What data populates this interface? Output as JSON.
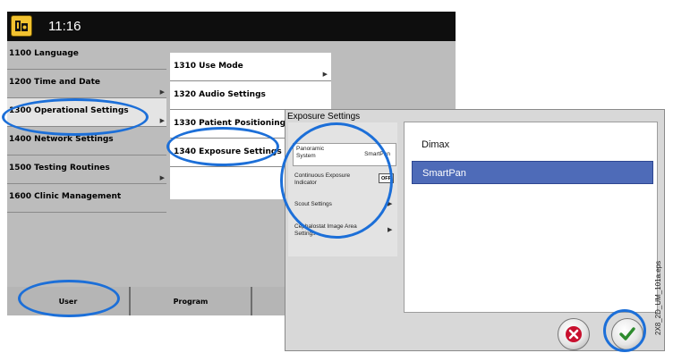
{
  "header": {
    "logo_icon": "panoramic-unit-icon",
    "time": "11:16"
  },
  "main_menu": [
    {
      "label": "1100  Language",
      "active": false,
      "arrow": false
    },
    {
      "label": "1200  Time and Date",
      "active": false,
      "arrow": true
    },
    {
      "label": "1300  Operational Settings",
      "active": true,
      "arrow": true
    },
    {
      "label": "1400  Network Settings",
      "active": false,
      "arrow": false
    },
    {
      "label": "1500  Testing Routines",
      "active": false,
      "arrow": true
    },
    {
      "label": "1600  Clinic Management",
      "active": false,
      "arrow": false
    }
  ],
  "submenu": [
    {
      "label": "1310  Use Mode",
      "arrow": true
    },
    {
      "label": "1320  Audio Settings",
      "arrow": false
    },
    {
      "label": "1330  Patient Positioning",
      "arrow": false
    },
    {
      "label": "1340  Exposure Settings",
      "arrow": false
    }
  ],
  "tabs": [
    {
      "label": "User"
    },
    {
      "label": "Program"
    },
    {
      "label": ""
    }
  ],
  "dialog": {
    "title": "Exposure Settings",
    "settings": {
      "panoramic_system_label_line1": "Panoramic",
      "panoramic_system_label_line2": "System",
      "panoramic_system_value": "SmartPan",
      "continuous_exposure_line1": "Continuous Exposure",
      "continuous_exposure_line2": "Indicator",
      "continuous_exposure_toggle": "OFF",
      "scout_settings": "Scout Settings",
      "cephalostat_line1": "Cephalostat Image Area",
      "cephalostat_line2": "Settings"
    },
    "options": [
      {
        "label": "Dimax",
        "selected": false
      },
      {
        "label": "SmartPan",
        "selected": true
      }
    ],
    "cancel_icon": "close-x-icon",
    "confirm_icon": "checkmark-icon"
  },
  "side_code": "2X8_2D_UM_101a.eps",
  "colors": {
    "highlight_ring": "#1c6fd8",
    "selection": "#4e6bb8",
    "cancel_red": "#c8102e",
    "confirm_green": "#2e8b2e"
  }
}
